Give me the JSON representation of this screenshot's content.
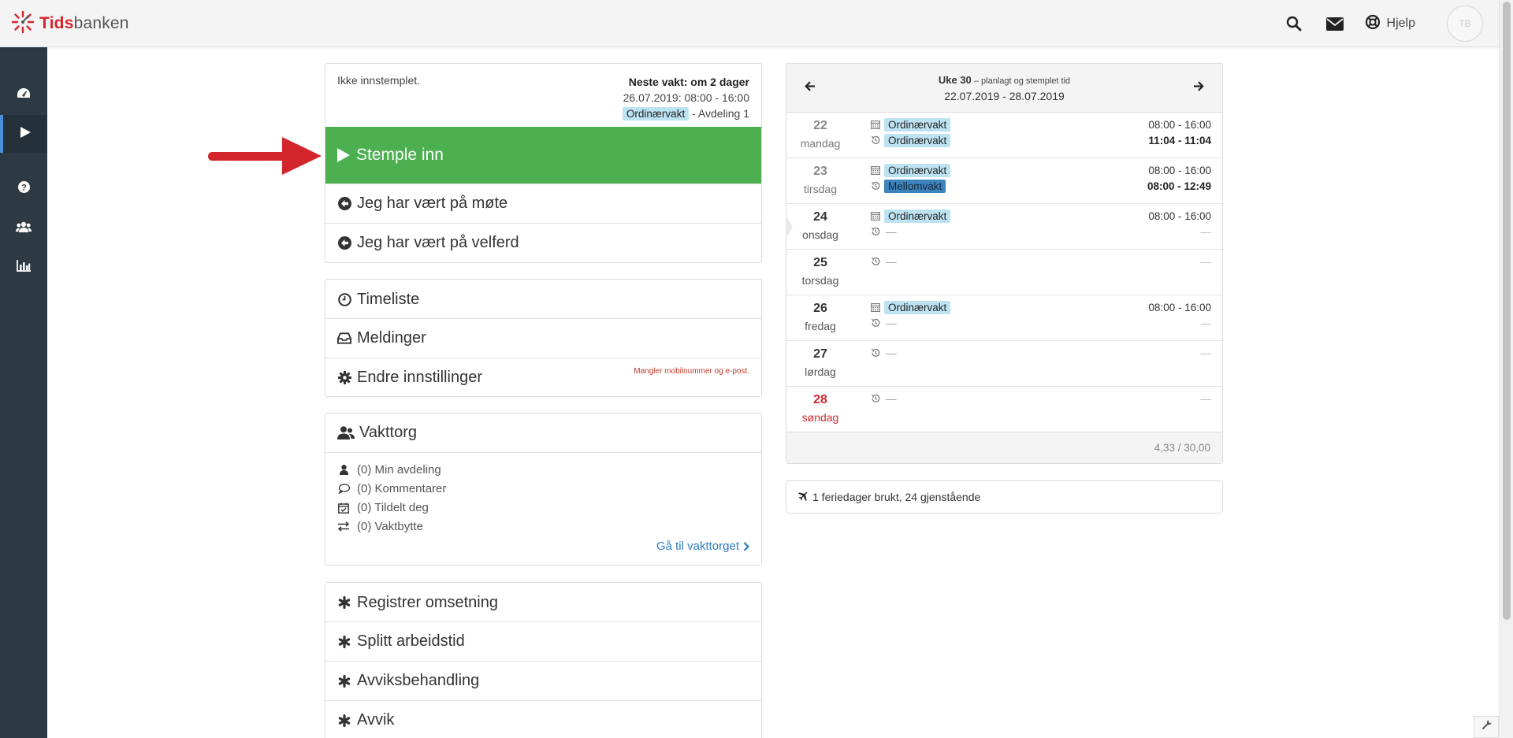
{
  "header": {
    "logo_prefix": "Tids",
    "logo_suffix": "banken",
    "help_label": "Hjelp",
    "avatar_initials": "TB"
  },
  "next_shift": {
    "status": "Ikke innstemplet.",
    "title": "Neste vakt: om 2 dager",
    "datetime": "26.07.2019: 08:00 - 16:00",
    "tag": "Ordinærvakt",
    "department": " - Avdeling 1"
  },
  "actions": {
    "stemple_inn": "Stemple inn",
    "mote": "Jeg har vært på møte",
    "velferd": "Jeg har vært på velferd"
  },
  "menu": {
    "timeliste": "Timeliste",
    "meldinger": "Meldinger",
    "innstillinger": "Endre innstillinger",
    "innstillinger_warning": "Mangler mobilnummer og e-post."
  },
  "vakttorg": {
    "title": "Vakttorg",
    "items": [
      "(0) Min avdeling",
      "(0) Kommentarer",
      "(0) Tildelt deg",
      "(0) Vaktbytte"
    ],
    "link": "Gå til vakttorget"
  },
  "extras": {
    "items": [
      "Registrer omsetning",
      "Splitt arbeidstid",
      "Avviksbehandling",
      "Avvik"
    ]
  },
  "calendar": {
    "week_label": "Uke 30",
    "week_sub": " – planlagt og stemplet tid",
    "range": "22.07.2019 - 28.07.2019",
    "days": [
      {
        "num": "22",
        "name": "mandag",
        "planned_tag": "Ordinærvakt",
        "planned_time": "08:00 - 16:00",
        "stamped_tag": "Ordinærvakt",
        "stamped_time": "11:04 - 11:04"
      },
      {
        "num": "23",
        "name": "tirsdag",
        "planned_tag": "Ordinærvakt",
        "planned_time": "08:00 - 16:00",
        "stamped_tag": "Mellomvakt",
        "stamped_time": "08:00 - 12:49"
      },
      {
        "num": "24",
        "name": "onsdag",
        "planned_tag": "Ordinærvakt",
        "planned_time": "08:00 - 16:00",
        "stamped_dash": "—",
        "stamped_time": "—"
      },
      {
        "num": "25",
        "name": "torsdag",
        "stamped_dash": "—",
        "stamped_time": "—"
      },
      {
        "num": "26",
        "name": "fredag",
        "planned_tag": "Ordinærvakt",
        "planned_time": "08:00 - 16:00",
        "stamped_dash": "—",
        "stamped_time": "—"
      },
      {
        "num": "27",
        "name": "lørdag",
        "stamped_dash": "—",
        "stamped_time": "—"
      },
      {
        "num": "28",
        "name": "søndag",
        "stamped_dash": "—",
        "stamped_time": "—"
      }
    ],
    "total": "4,33 / 30,00"
  },
  "ferie": {
    "text": "1 feriedager brukt, 24 gjenstående"
  },
  "colors": {
    "brand_red": "#d3262c",
    "sidebar": "#2d3a43",
    "stemple_green": "#4caf50",
    "tag_light": "#bde3f3",
    "tag_dark": "#3d84be",
    "link_blue": "#2e7bbf"
  },
  "icons": {
    "sidebar": [
      "dashboard-icon",
      "play-icon",
      "help-icon",
      "users-icon",
      "chart-icon"
    ],
    "topbar": [
      "search-icon",
      "mail-icon",
      "lifebuoy-icon"
    ]
  }
}
